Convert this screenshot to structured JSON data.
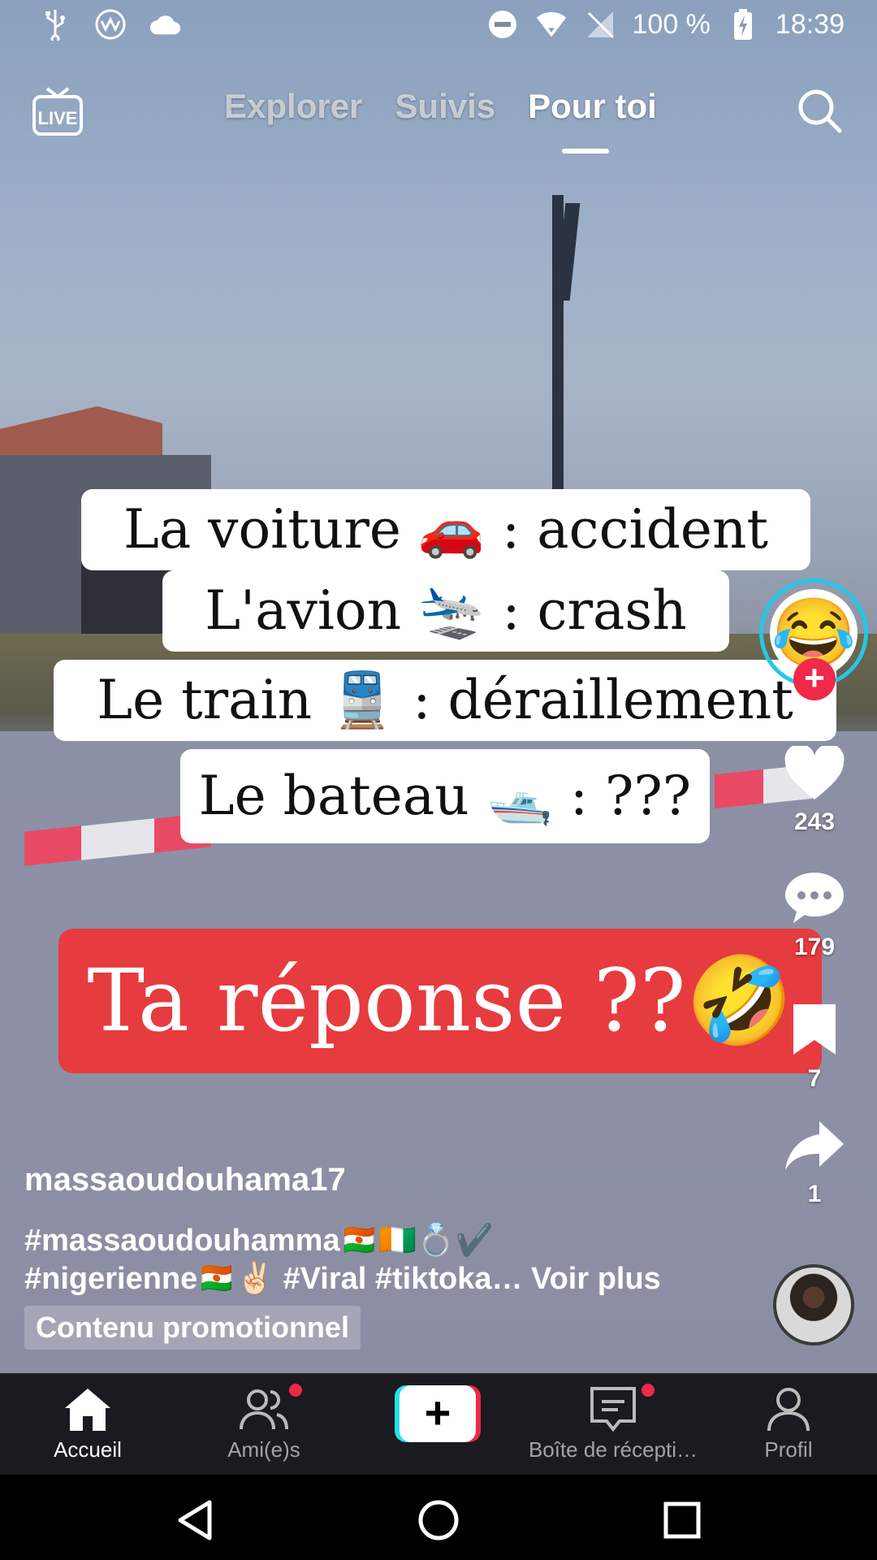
{
  "status_bar": {
    "battery": "100 %",
    "time": "18:39",
    "icons": [
      "usb-icon",
      "vpn-icon",
      "cloud-icon",
      "dnd-icon",
      "wifi-icon",
      "no-sim-icon",
      "battery-charging-icon"
    ]
  },
  "top_nav": {
    "live_icon": "live-tv-icon",
    "live_label": "LIVE",
    "tabs": [
      {
        "label": "Explorer",
        "active": false
      },
      {
        "label": "Suivis",
        "active": false
      },
      {
        "label": "Pour toi",
        "active": true
      }
    ],
    "search_icon": "search-icon"
  },
  "video": {
    "caption_lines": [
      "La voiture 🚗 : accident",
      "L'avion 🛬 : crash",
      "Le train 🚆 : déraillement",
      "Le bateau 🛥️ : ???"
    ],
    "answer_text": "Ta réponse ??🤣"
  },
  "actions": {
    "avatar_emoji": "😂",
    "follow_symbol": "+",
    "likes": "243",
    "comments": "179",
    "saves": "7",
    "shares": "1"
  },
  "post": {
    "username": "massaoudouhama17",
    "description_line1": "#massaoudouhamma🇳🇪🇨🇮💍✔️",
    "description_line2": "#nigerienne🇳🇪✌🏻 #Viral #tiktoka…",
    "voir_plus": "Voir plus",
    "promo_label": "Contenu promotionnel"
  },
  "bottom_nav": {
    "items": [
      {
        "label": "Accueil",
        "icon": "home-icon",
        "active": true
      },
      {
        "label": "Ami(e)s",
        "icon": "friends-icon",
        "active": false,
        "badge": true
      },
      {
        "label": "",
        "icon": "create-icon",
        "symbol": "+"
      },
      {
        "label": "Boîte de récepti…",
        "icon": "inbox-icon",
        "active": false,
        "badge": true
      },
      {
        "label": "Profil",
        "icon": "profile-icon",
        "active": false
      }
    ]
  },
  "system_nav": {
    "icons": [
      "back-icon",
      "home-circle-icon",
      "recents-icon"
    ]
  },
  "colors": {
    "accent_red": "#f0284a",
    "accent_cyan": "#25e0e6",
    "answer_box": "#e63b3f",
    "nav_bg": "#1a1a20"
  }
}
